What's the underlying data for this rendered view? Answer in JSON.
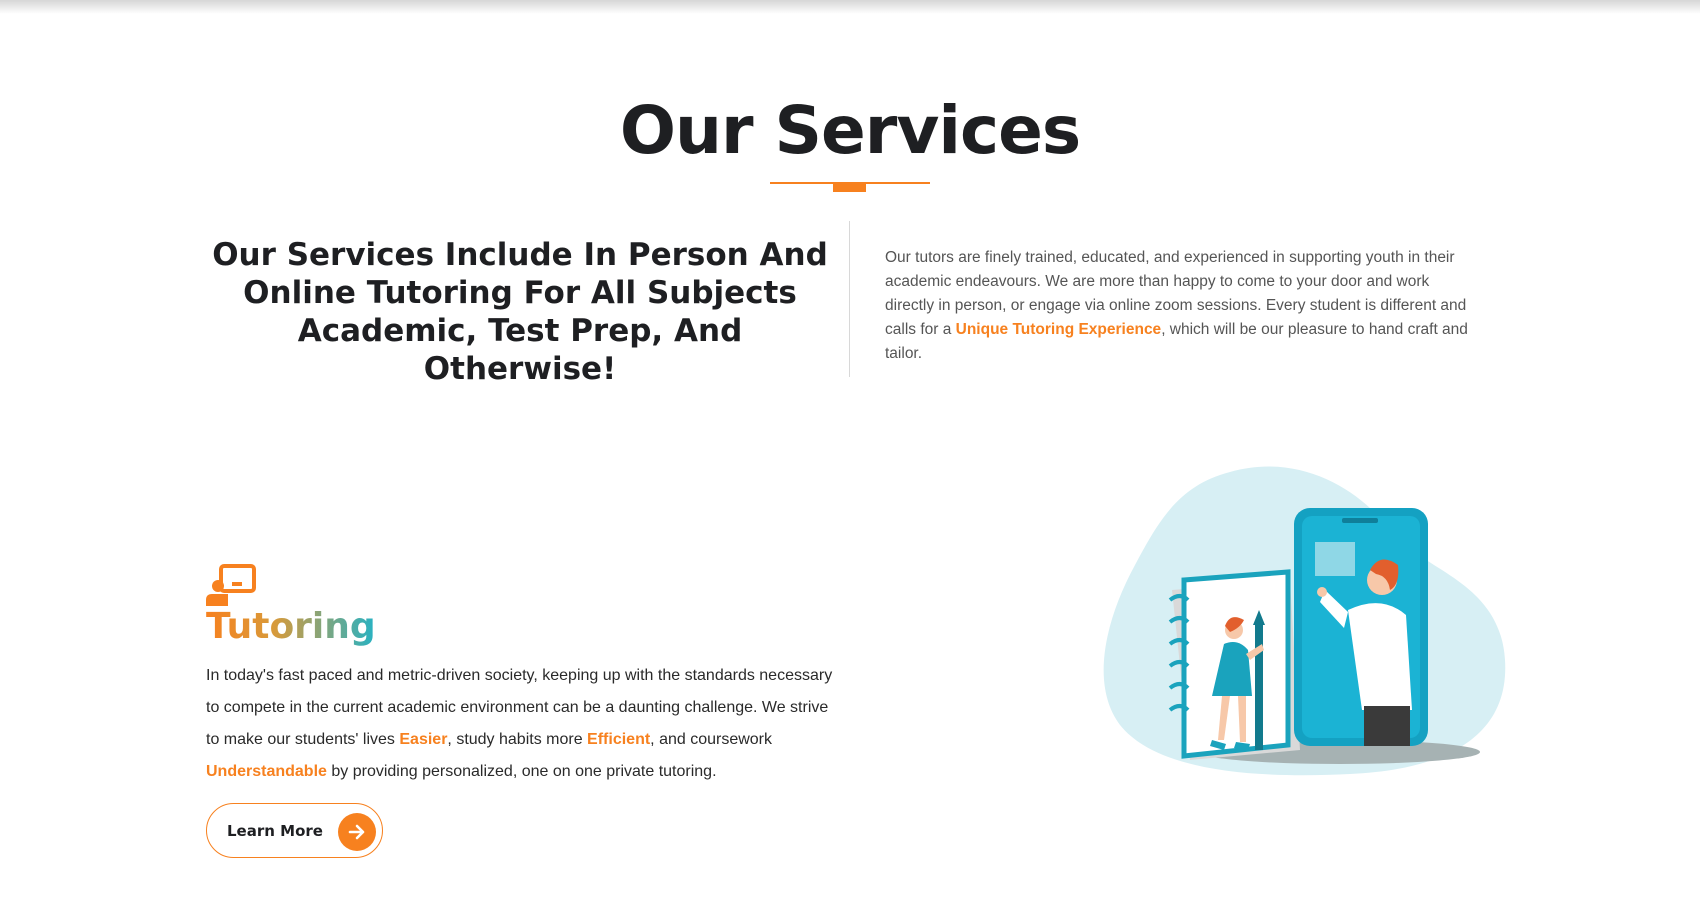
{
  "colors": {
    "accent": "#f7811f",
    "teal": "#26b2c4",
    "heading": "#1e1f22"
  },
  "section": {
    "title": "Our Services"
  },
  "intro": {
    "heading": "Our Services Include In Person And Online Tutoring For All Subjects Academic, Test Prep, And Otherwise!",
    "text_before": "Our tutors are finely trained, educated, and experienced in supporting youth in their academic endeavours. We are more than happy to come to your door and work directly in person, or engage via online zoom sessions. Every student is different and calls for a ",
    "highlight": "Unique Tutoring Experience",
    "text_after": ", which will be our pleasure to hand craft and tailor."
  },
  "service": {
    "icon": "presenter-board-icon",
    "title": "Tutoring",
    "text_1": "In today's fast paced and metric-driven society, keeping up with the standards necessary to compete in the current academic environment can be a daunting challenge. We strive to make our students' lives ",
    "hl_1": "Easier",
    "text_2": ", study habits more ",
    "hl_2": "Efficient",
    "text_3": ", and coursework ",
    "hl_3": "Understandable",
    "text_4": " by providing personalized, one on one private tutoring.",
    "button_label": "Learn More",
    "button_icon": "arrow-right-icon",
    "illustration": "online-tutoring-illustration"
  }
}
